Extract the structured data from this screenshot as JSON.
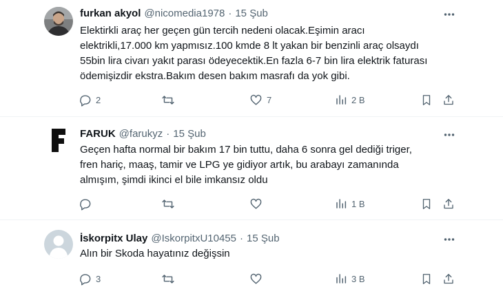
{
  "tweets": [
    {
      "name": "furkan akyol",
      "handle": "@nicomedia1978",
      "dot": "·",
      "time": "15 Şub",
      "avatar": "photo-avatar",
      "lines": [
        "Elektirkli araç her geçen gün tercih nedeni olacak.Eşimin aracı",
        "elektrikli,17.000 km yapmısız.100 kmde 8 lt yakan bir benzinli araç olsaydı",
        "55bin lira civarı yakıt parası ödeyecektik.En fazla 6-7 bin lira elektrik faturası",
        "ödemişizdir ekstra.Bakım desen bakım masrafı da yok gibi."
      ],
      "replies": "2",
      "retweets": "",
      "likes": "7",
      "views": "2 B"
    },
    {
      "name": "FARUK",
      "handle": "@farukyz",
      "dot": "·",
      "time": "15 Şub",
      "avatar": "letter-f-logo",
      "lines": [
        "Geçen hafta normal bir bakım 17 bin tuttu, daha 6 sonra gel dediği triger,",
        "fren hariç, maaş, tamir ve LPG ye gidiyor artık, bu arabayı zamanında",
        "almışım, şimdi ikinci el bile imkansız oldu"
      ],
      "replies": "",
      "retweets": "",
      "likes": "",
      "views": "1 B"
    },
    {
      "name": "İskorpitx Ulay",
      "handle": "@IskorpitxU10455",
      "dot": "·",
      "time": "15 Şub",
      "avatar": "default-avatar",
      "lines": [
        "Alın bir Skoda hayatınız değişsin"
      ],
      "replies": "3",
      "retweets": "",
      "likes": "",
      "views": "3 B"
    }
  ],
  "icons": {
    "more": "more-dots-icon",
    "reply": "reply-icon",
    "retweet": "retweet-icon",
    "like": "heart-icon",
    "views": "views-chart-icon",
    "bookmark": "bookmark-icon",
    "share": "share-icon"
  },
  "colors": {
    "text": "#0f1419",
    "secondary": "#536471",
    "divider": "#eff3f4",
    "default_avatar": "#ccd6dd"
  }
}
